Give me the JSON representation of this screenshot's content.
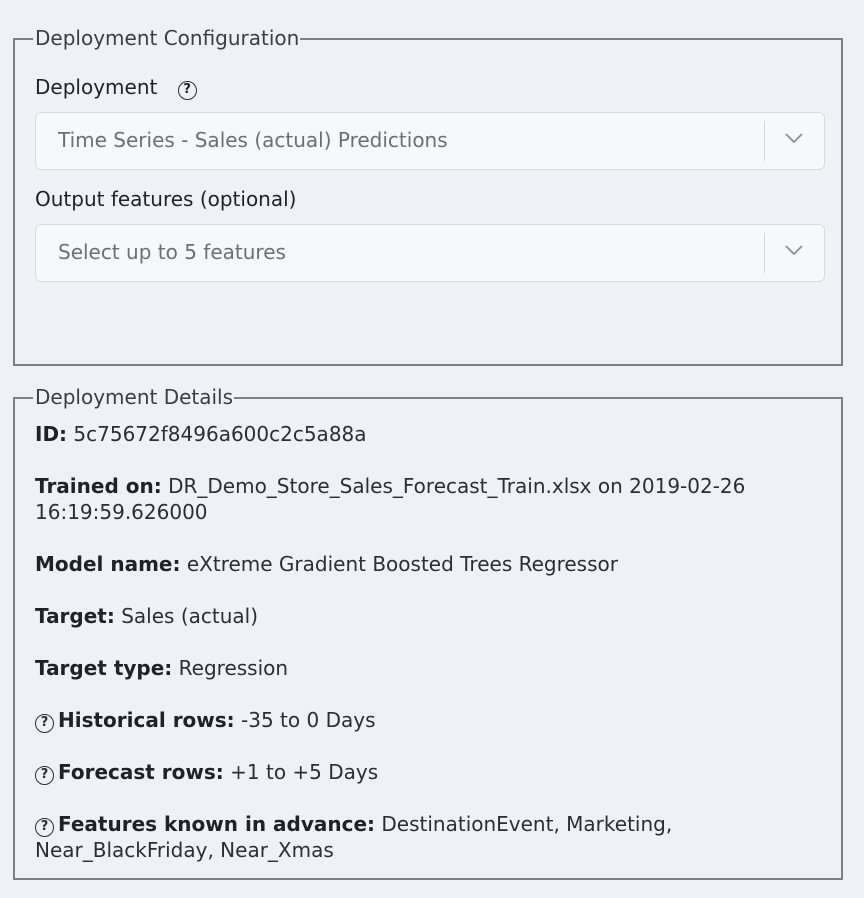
{
  "config": {
    "legend": "Deployment Configuration",
    "deployment_label": "Deployment",
    "deployment_value": "Time Series - Sales (actual) Predictions",
    "output_label": "Output features (optional)",
    "output_placeholder": "Select up to 5 features"
  },
  "details": {
    "legend": "Deployment Details",
    "id_key": "ID:",
    "id_value": "5c75672f8496a600c2c5a88a",
    "trained_key": "Trained on:",
    "trained_value": "DR_Demo_Store_Sales_Forecast_Train.xlsx on 2019-02-26 16:19:59.626000",
    "model_key": "Model name:",
    "model_value": "eXtreme Gradient Boosted Trees Regressor",
    "target_key": "Target:",
    "target_value": "Sales (actual)",
    "target_type_key": "Target type:",
    "target_type_value": "Regression",
    "historical_key": "Historical rows:",
    "historical_value": "-35 to 0 Days",
    "forecast_key": "Forecast rows:",
    "forecast_value": "+1 to +5 Days",
    "known_key": "Features known in advance:",
    "known_value": "DestinationEvent, Marketing, Near_BlackFriday, Near_Xmas"
  },
  "icons": {
    "help": "help-circle-icon",
    "chevron": "chevron-down-icon"
  }
}
